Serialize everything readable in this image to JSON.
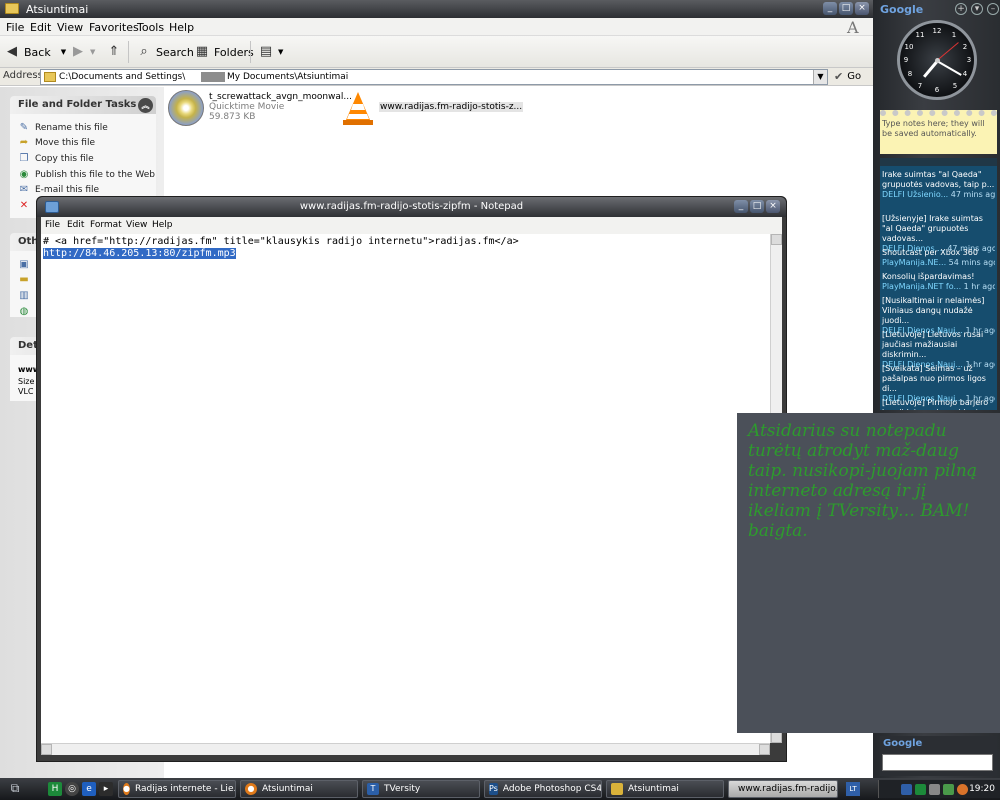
{
  "explorer": {
    "title": "Atsiuntimai",
    "menu": [
      "File",
      "Edit",
      "View",
      "Favorites",
      "Tools",
      "Help"
    ],
    "toolbar": {
      "back": "Back",
      "search": "Search",
      "folders": "Folders"
    },
    "address": {
      "label": "Address",
      "path_a": "C:\\Documents and Settings\\",
      "path_b": "My Documents\\Atsiuntimai",
      "go": "Go"
    },
    "tasks": {
      "file_folder_title": "File and Folder Tasks",
      "items": [
        "Rename this file",
        "Move this file",
        "Copy this file",
        "Publish this file to the Web",
        "E-mail this file"
      ],
      "other_title": "Oth",
      "details_title": "Det",
      "details_lines": [
        "www",
        "Size",
        "VLC"
      ]
    },
    "files": [
      {
        "name": "t_screwattack_avgn_moonwal...",
        "type": "Quicktime Movie",
        "size": "59.873 KB"
      },
      {
        "name": "www.radijas.fm-radijo-stotis-z..."
      }
    ]
  },
  "notepad": {
    "title": "www.radijas.fm-radijo-stotis-zipfm - Notepad",
    "menu": [
      "File",
      "Edit",
      "Format",
      "View",
      "Help"
    ],
    "line1": "# <a href=\"http://radijas.fm\" title=\"klausykis radijo internetu\">radijas.fm</a>",
    "line2": "http://84.46.205.13:80/zipfm.mp3"
  },
  "sidebar": {
    "google_label": "Google",
    "notes": "Type notes here; they will be saved automatically.",
    "rss": [
      {
        "title": "Irake suimtas \"al Qaeda\" grupuotės vadovas, taip p...",
        "source": "DELFI Užsienio...",
        "ago": "47 mins ago"
      },
      {
        "title": "[Užsienyje] Irake suimtas \"al Qaeda\" grupuotės vadovas...",
        "source": "DELFI Dienos ...",
        "ago": "47 mins ago"
      },
      {
        "title": "Shoutcast per Xbox 360",
        "source": "PlayManija.NE...",
        "ago": "54 mins ago"
      },
      {
        "title": "Konsolių išpardavimas!",
        "source": "PlayManija.NET fo...",
        "ago": "1 hr ago"
      },
      {
        "title": "[Nusikaltimai ir nelaimės] Vilniaus dangų nudažė juodi...",
        "source": "DELFI Dienos Nauj...",
        "ago": "1 hr ago"
      },
      {
        "title": "[Lietuvoje] Lietuvos rusai jaučiasi mažiausiai diskrimin...",
        "source": "DELFI Dienos Nauj...",
        "ago": "1 hr ago"
      },
      {
        "title": "[Sveikata] Seimas – už pašalpas nuo pirmos ligos di...",
        "source": "DELFI Dienos Nauj...",
        "ago": "1 hr ago"
      },
      {
        "title": "[Lietuvoje] Pirmojo barjero kandidatams į prezidentus",
        "source": "",
        "ago": ""
      }
    ],
    "google_search_label": "Google"
  },
  "annotation": {
    "text": "Atsidarius su notepadu turėtų atrodyt maž-daug taip. nusikopi-juojam pilną interneto adresą ir jį ikeliam į TVersity… BAM! baigta."
  },
  "taskbar": {
    "buttons": [
      {
        "label": "Radijas internete - Lie..."
      },
      {
        "label": "Atsiuntimai"
      },
      {
        "label": "TVersity"
      },
      {
        "label": "Adobe Photoshop CS4..."
      },
      {
        "label": "Atsiuntimai"
      },
      {
        "label": "www.radijas.fm-radijo..."
      }
    ],
    "lang": "LT",
    "time": "19:20"
  }
}
